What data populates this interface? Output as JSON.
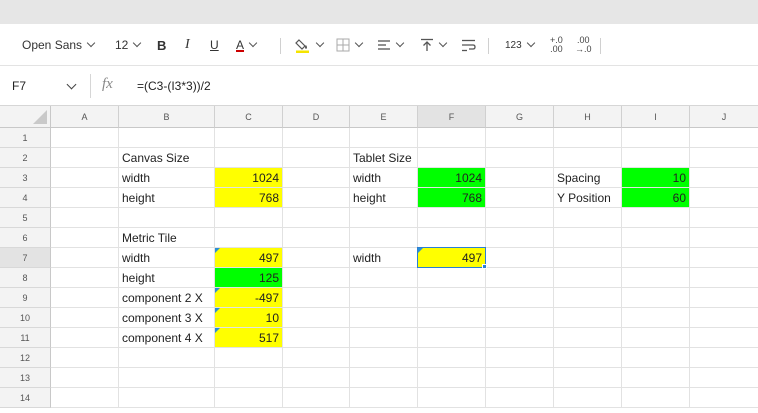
{
  "toolbar": {
    "font_family": "Open Sans",
    "font_size": "12",
    "bold": "B",
    "italic": "I",
    "underline": "U",
    "font_color": "A",
    "number_format": "123",
    "increase_decimals_top": "+.0",
    "increase_decimals_bottom": ".00",
    "decrease_decimals_top": ".00",
    "decrease_decimals_bottom": "→.0"
  },
  "formula_bar": {
    "cell_ref": "F7",
    "fx": "fx",
    "formula": "=(C3-(I3*3))/2"
  },
  "columns": [
    "A",
    "B",
    "C",
    "D",
    "E",
    "F",
    "G",
    "H",
    "I",
    "J"
  ],
  "rows": [
    "1",
    "2",
    "3",
    "4",
    "5",
    "6",
    "7",
    "8",
    "9",
    "10",
    "11",
    "12",
    "13",
    "14"
  ],
  "selected_cell": "F7",
  "colors": {
    "yellow": "#ffff00",
    "green": "#00ff00",
    "selection": "#2b7fd3"
  },
  "cells": {
    "B2": "Canvas Size",
    "B3": "width",
    "C3": "1024",
    "B4": "height",
    "C4": "768",
    "E2": "Tablet Size",
    "E3": "width",
    "F3": "1024",
    "E4": "height",
    "F4": "768",
    "H3": "Spacing",
    "I3": "10",
    "H4": "Y Position",
    "I4": "60",
    "B6": "Metric Tile",
    "B7": "width",
    "C7": "497",
    "B8": "height",
    "C8": "125",
    "B9": "component 2 X",
    "C9": "-497",
    "B10": "component 3 X",
    "C10": "10",
    "B11": "component 4 X",
    "C11": "517",
    "E7": "width",
    "F7": "497"
  }
}
